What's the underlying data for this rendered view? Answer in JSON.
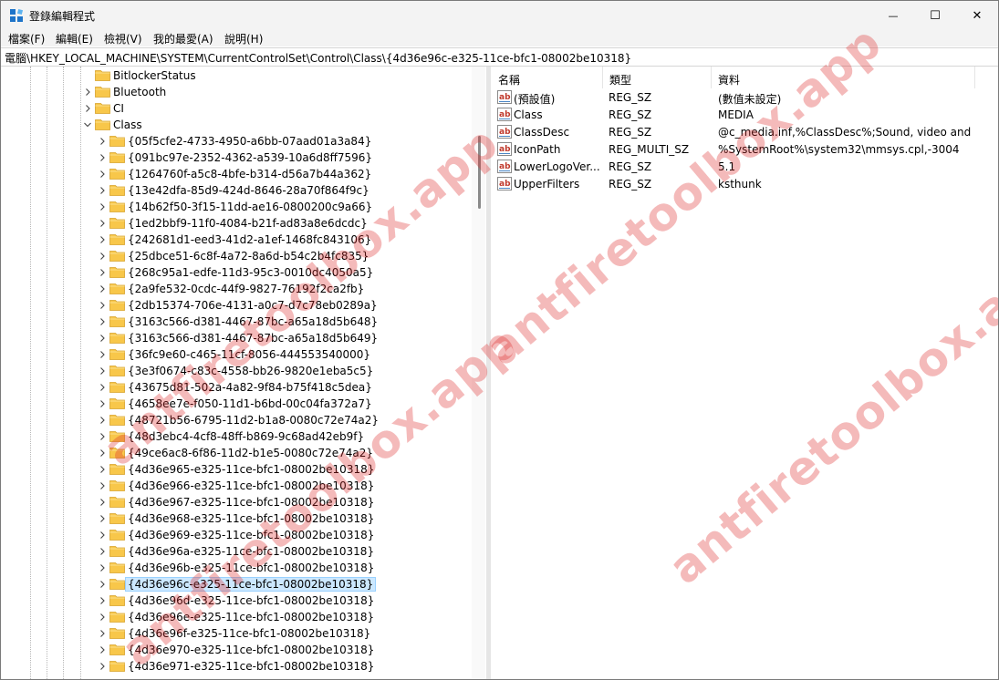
{
  "window": {
    "title": "登錄編輯程式",
    "controls": {
      "minimize": "—",
      "maximize": "☐",
      "close": "✕"
    }
  },
  "menu": [
    {
      "label": "檔案(F)"
    },
    {
      "label": "編輯(E)"
    },
    {
      "label": "檢視(V)"
    },
    {
      "label": "我的最愛(A)"
    },
    {
      "label": "說明(H)"
    }
  ],
  "address": {
    "path": "電腦\\HKEY_LOCAL_MACHINE\\SYSTEM\\CurrentControlSet\\Control\\Class\\{4d36e96c-e325-11ce-bfc1-08002be10318}"
  },
  "tree": {
    "parent_siblings": [
      {
        "label": "BitlockerStatus",
        "expandable": false
      },
      {
        "label": "Bluetooth",
        "expandable": true
      },
      {
        "label": "CI",
        "expandable": true
      }
    ],
    "expanded": {
      "label": "Class"
    },
    "children": [
      "{05f5cfe2-4733-4950-a6bb-07aad01a3a84}",
      "{091bc97e-2352-4362-a539-10a6d8ff7596}",
      "{1264760f-a5c8-4bfe-b314-d56a7b44a362}",
      "{13e42dfa-85d9-424d-8646-28a70f864f9c}",
      "{14b62f50-3f15-11dd-ae16-0800200c9a66}",
      "{1ed2bbf9-11f0-4084-b21f-ad83a8e6dcdc}",
      "{242681d1-eed3-41d2-a1ef-1468fc843106}",
      "{25dbce51-6c8f-4a72-8a6d-b54c2b4fc835}",
      "{268c95a1-edfe-11d3-95c3-0010dc4050a5}",
      "{2a9fe532-0cdc-44f9-9827-76192f2ca2fb}",
      "{2db15374-706e-4131-a0c7-d7c78eb0289a}",
      "{3163c566-d381-4467-87bc-a65a18d5b648}",
      "{3163c566-d381-4467-87bc-a65a18d5b649}",
      "{36fc9e60-c465-11cf-8056-444553540000}",
      "{3e3f0674-c83c-4558-bb26-9820e1eba5c5}",
      "{43675d81-502a-4a82-9f84-b75f418c5dea}",
      "{4658ee7e-f050-11d1-b6bd-00c04fa372a7}",
      "{48721b56-6795-11d2-b1a8-0080c72e74a2}",
      "{48d3ebc4-4cf8-48ff-b869-9c68ad42eb9f}",
      "{49ce6ac8-6f86-11d2-b1e5-0080c72e74a2}",
      "{4d36e965-e325-11ce-bfc1-08002be10318}",
      "{4d36e966-e325-11ce-bfc1-08002be10318}",
      "{4d36e967-e325-11ce-bfc1-08002be10318}",
      "{4d36e968-e325-11ce-bfc1-08002be10318}",
      "{4d36e969-e325-11ce-bfc1-08002be10318}",
      "{4d36e96a-e325-11ce-bfc1-08002be10318}",
      "{4d36e96b-e325-11ce-bfc1-08002be10318}",
      "{4d36e96c-e325-11ce-bfc1-08002be10318}",
      "{4d36e96d-e325-11ce-bfc1-08002be10318}",
      "{4d36e96e-e325-11ce-bfc1-08002be10318}",
      "{4d36e96f-e325-11ce-bfc1-08002be10318}",
      "{4d36e970-e325-11ce-bfc1-08002be10318}",
      "{4d36e971-e325-11ce-bfc1-08002be10318}"
    ],
    "selected": "{4d36e96c-e325-11ce-bfc1-08002be10318}"
  },
  "values": {
    "columns": [
      "名稱",
      "類型",
      "資料"
    ],
    "rows": [
      {
        "name": "(預設值)",
        "type": "REG_SZ",
        "data": "(數值未設定)"
      },
      {
        "name": "Class",
        "type": "REG_SZ",
        "data": "MEDIA"
      },
      {
        "name": "ClassDesc",
        "type": "REG_SZ",
        "data": "@c_media.inf,%ClassDesc%;Sound, video and ..."
      },
      {
        "name": "IconPath",
        "type": "REG_MULTI_SZ",
        "data": "%SystemRoot%\\system32\\mmsys.cpl,-3004"
      },
      {
        "name": "LowerLogoVer...",
        "type": "REG_SZ",
        "data": "5.1"
      },
      {
        "name": "UpperFilters",
        "type": "REG_SZ",
        "data": "ksthunk"
      }
    ]
  },
  "watermark": {
    "text": "antfiretoolbox.app",
    "color": "#dc2828"
  },
  "icons": {
    "app": "registry-editor-icon",
    "folder": "folder-icon",
    "chevron_right": "chevron-right-icon",
    "chevron_down": "chevron-down-icon",
    "string_value": "string-value-icon"
  },
  "colors": {
    "folder": "#f8c74a",
    "selection": "#cce8ff"
  }
}
